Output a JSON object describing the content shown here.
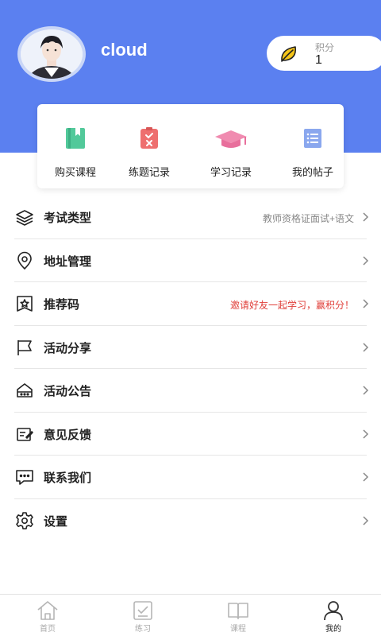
{
  "profile": {
    "username": "cloud",
    "points_label": "积分",
    "points_value": "1"
  },
  "quick_actions": [
    {
      "label": "购买课程",
      "icon": "bookmark-book-icon",
      "color": "#52c99a"
    },
    {
      "label": "练题记录",
      "icon": "checklist-icon",
      "color": "#ee6f6f"
    },
    {
      "label": "学习记录",
      "icon": "graduation-cap-icon",
      "color": "#f08bb0"
    },
    {
      "label": "我的帖子",
      "icon": "list-icon",
      "color": "#8aa7ee"
    }
  ],
  "menu": [
    {
      "label": "考试类型",
      "icon": "layers-icon",
      "extra": "教师资格证面试+语文"
    },
    {
      "label": "地址管理",
      "icon": "location-pin-icon",
      "extra": ""
    },
    {
      "label": "推荐码",
      "icon": "star-badge-icon",
      "extra": "邀请好友一起学习，赢积分！"
    },
    {
      "label": "活动分享",
      "icon": "flag-icon",
      "extra": ""
    },
    {
      "label": "活动公告",
      "icon": "announcement-icon",
      "extra": ""
    },
    {
      "label": "意见反馈",
      "icon": "feedback-icon",
      "extra": ""
    },
    {
      "label": "联系我们",
      "icon": "chat-icon",
      "extra": ""
    },
    {
      "label": "设置",
      "icon": "gear-icon",
      "extra": ""
    }
  ],
  "tabbar": [
    {
      "label": "首页",
      "icon": "home-icon",
      "active": false
    },
    {
      "label": "练习",
      "icon": "practice-icon",
      "active": false
    },
    {
      "label": "课程",
      "icon": "book-icon",
      "active": false
    },
    {
      "label": "我的",
      "icon": "user-icon",
      "active": true
    }
  ],
  "colors": {
    "header": "#5b80f0",
    "points_icon": "#f5c518",
    "accent_red": "#e0403b"
  }
}
